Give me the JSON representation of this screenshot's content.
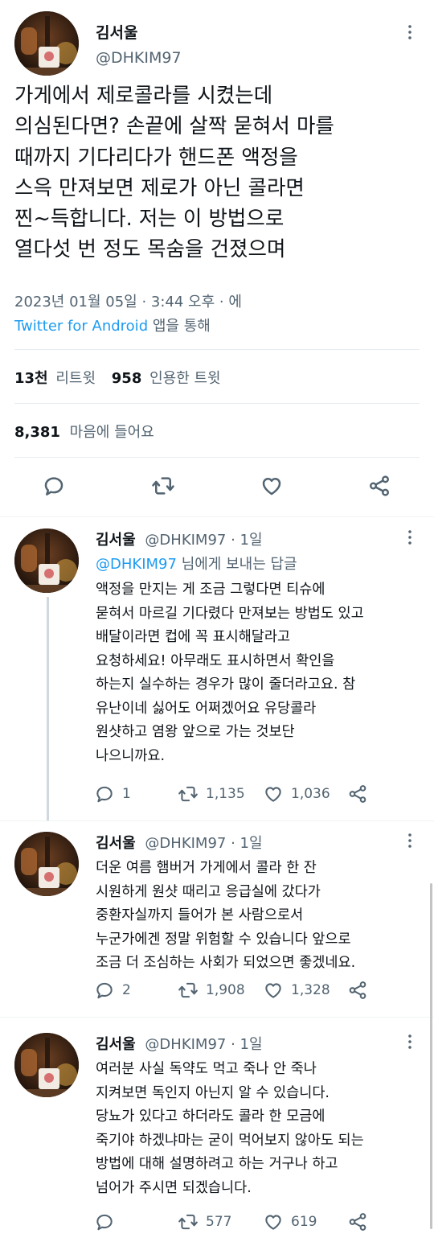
{
  "main_tweet": {
    "author_name": "김서울",
    "handle": "@DHKIM97",
    "text_lines": [
      "가게에서 제로콜라를 시켰는데",
      "의심된다면? 손끝에 살짝 묻혀서 마를",
      "때까지 기다리다가 핸드폰 액정을",
      "스윽 만져보면 제로가 아닌 콜라면",
      "찐~득합니다. 저는 이 방법으로",
      "열다섯 번 정도 목숨을 건졌으며"
    ],
    "timestamp": "2023년 01월 05일 · 3:44 오후 · 에",
    "source_app": "Twitter for Android",
    "source_suffix": "앱을 통해",
    "retweets_count": "13천",
    "retweets_label": "리트윗",
    "quotes_count": "958",
    "quotes_label": "인용한 트윗",
    "likes_count": "8,381",
    "likes_label": "마음에 들어요"
  },
  "replies": [
    {
      "author_name": "김서울",
      "handle_time": "@DHKIM97 · 1일",
      "replying_to_handle": "@DHKIM97",
      "replying_to_suffix": "님에게 보내는 답글",
      "text_lines": [
        "액정을 만지는 게 조금 그렇다면 티슈에",
        "묻혀서 마르길 기다렸다 만져보는 방법도 있고",
        "배달이라면 컵에 꼭 표시해달라고",
        "요청하세요! 아무래도 표시하면서 확인을",
        "하는지 실수하는 경우가 많이 줄더라고요. 참",
        "유난이네 싫어도 어쩌겠어요 유당콜라",
        "원샷하고 염왕 앞으로 가는 것보단",
        "나으니까요."
      ],
      "reply_count": "1",
      "retweet_count": "1,135",
      "like_count": "1,036"
    },
    {
      "author_name": "김서울",
      "handle_time": "@DHKIM97 · 1일",
      "text_lines": [
        "더운 여름 햄버거 가게에서 콜라 한 잔",
        "시원하게 원샷 때리고 응급실에 갔다가",
        "중환자실까지 들어가 본 사람으로서",
        "누군가에겐 정말 위험할 수 있습니다 앞으로",
        "조금 더 조심하는 사회가 되었으면 좋겠네요."
      ],
      "reply_count": "2",
      "retweet_count": "1,908",
      "like_count": "1,328"
    },
    {
      "author_name": "김서울",
      "handle_time": "@DHKIM97 · 1일",
      "text_lines": [
        "여러분 사실 독약도 먹고 죽나 안 죽나",
        "지켜보면 독인지 아닌지 알 수 있습니다.",
        "당뇨가 있다고 하더라도 콜라 한 모금에",
        "죽기야 하겠냐마는 굳이 먹어보지 않아도 되는",
        "방법에 대해 설명하려고 하는 거구나 하고",
        "넘어가 주시면 되겠습니다."
      ],
      "retweet_count": "577",
      "like_count": "619"
    }
  ],
  "icons": {
    "reply": "reply-icon",
    "retweet": "retweet-icon",
    "like": "heart-icon",
    "share": "share-icon",
    "more": "more-dots-icon"
  },
  "colors": {
    "link": "#1d9bf0",
    "secondary_text": "#536471",
    "divider": "#eff3f4"
  }
}
